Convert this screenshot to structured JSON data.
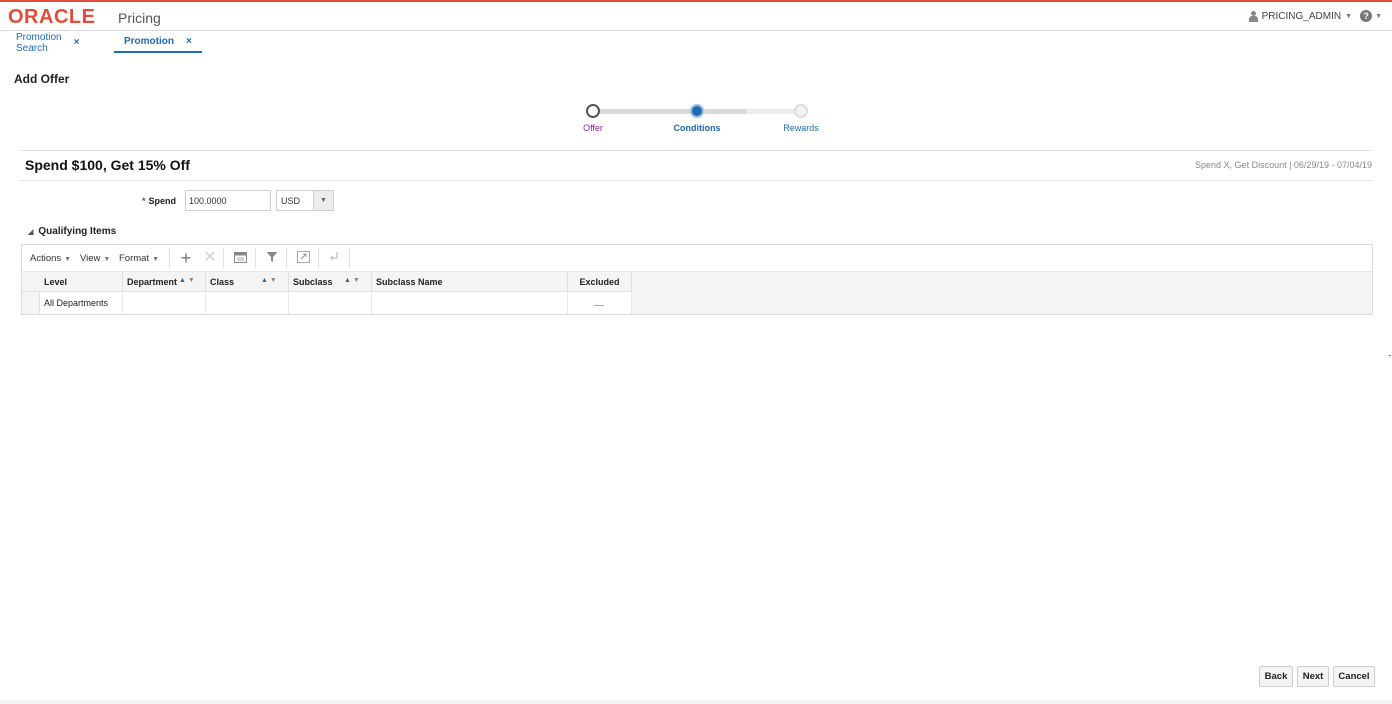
{
  "header": {
    "logo": "ORACLE",
    "app_name": "Pricing",
    "user": "PRICING_ADMIN"
  },
  "tabs": [
    {
      "label": "Promotion Search",
      "active": false
    },
    {
      "label": "Promotion",
      "active": true
    }
  ],
  "page_title": "Add Offer",
  "train": {
    "steps": [
      {
        "label": "Offer",
        "state": "done",
        "color": "#8b2a8f"
      },
      {
        "label": "Conditions",
        "state": "current",
        "color": "#1e6ab5"
      },
      {
        "label": "Rewards",
        "state": "future",
        "color": "#1e6ab5"
      }
    ]
  },
  "offer": {
    "title": "Spend $100, Get 15% Off",
    "meta": "Spend X, Get Discount | 06/29/19 - 07/04/19"
  },
  "spend": {
    "required_mark": "*",
    "label": "Spend",
    "value": "100.0000",
    "currency": "USD"
  },
  "qualifying_items": {
    "section_title": "Qualifying Items",
    "toolbar": {
      "actions": "Actions",
      "view": "View",
      "format": "Format",
      "icons": [
        "add-icon",
        "delete-icon",
        "calendar-icon",
        "filter-icon",
        "detach-icon",
        "wrap-icon"
      ]
    },
    "columns": [
      "Level",
      "Department",
      "Class",
      "Subclass",
      "Subclass Name",
      "Excluded"
    ],
    "rows": [
      {
        "level": "All Departments",
        "department": "",
        "class": "",
        "subclass": "",
        "subclass_name": "",
        "excluded": ""
      }
    ]
  },
  "footer": {
    "back": "Back",
    "next": "Next",
    "cancel": "Cancel"
  },
  "colors": {
    "brand": "#e44c3a",
    "link": "#1e6ab5"
  }
}
